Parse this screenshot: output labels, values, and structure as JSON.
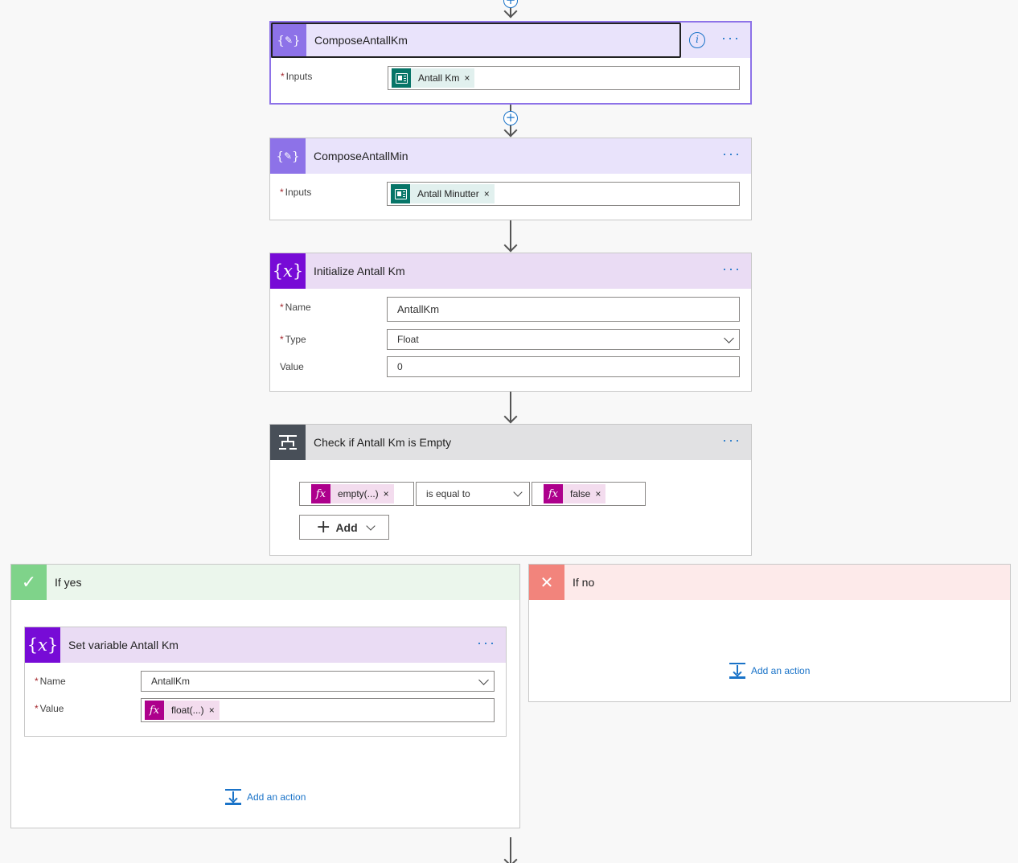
{
  "steps": {
    "compose_km": {
      "title": "ComposeAntallKm",
      "inputs_label": "Inputs",
      "token_label": "Antall Km"
    },
    "compose_min": {
      "title": "ComposeAntallMin",
      "inputs_label": "Inputs",
      "token_label": "Antall Minutter"
    },
    "init_var": {
      "title": "Initialize Antall Km",
      "name_label": "Name",
      "name_value": "AntallKm",
      "type_label": "Type",
      "type_value": "Float",
      "value_label": "Value",
      "value_value": "0"
    },
    "condition": {
      "title": "Check if Antall Km is Empty",
      "left_token": "empty(...)",
      "operator": "is equal to",
      "right_token": "false",
      "add_label": "Add"
    }
  },
  "branches": {
    "yes": {
      "title": "If yes",
      "set_var": {
        "title": "Set variable Antall Km",
        "name_label": "Name",
        "name_value": "AntallKm",
        "value_label": "Value",
        "value_token": "float(...)"
      },
      "add_action": "Add an action"
    },
    "no": {
      "title": "If no",
      "add_action": "Add an action"
    }
  },
  "common": {
    "more_glyph": "···",
    "token_remove": "×",
    "required_mark": "*",
    "info_glyph": "i",
    "fx_glyph": "fx",
    "plus_glyph": "+",
    "check_glyph": "✓",
    "cross_glyph": "✕"
  },
  "colors": {
    "compose_accent": "#8d72e8",
    "variable_accent": "#770bd6",
    "condition_accent": "#484f58",
    "forms_token": "#077568",
    "expression_token": "#ad008c",
    "yes_branch": "#7fd38a",
    "no_branch": "#f2847c",
    "link_blue": "#1a73c8"
  },
  "icons": {
    "compose": "compose-braces-icon",
    "variable": "variable-x-icon",
    "condition": "condition-icon",
    "forms": "forms-icon",
    "expression": "fx-icon",
    "yes": "checkmark-icon",
    "no": "close-icon",
    "add_action": "add-action-icon",
    "info": "info-icon",
    "more": "more-options-icon",
    "insert": "plus-circle-icon"
  }
}
